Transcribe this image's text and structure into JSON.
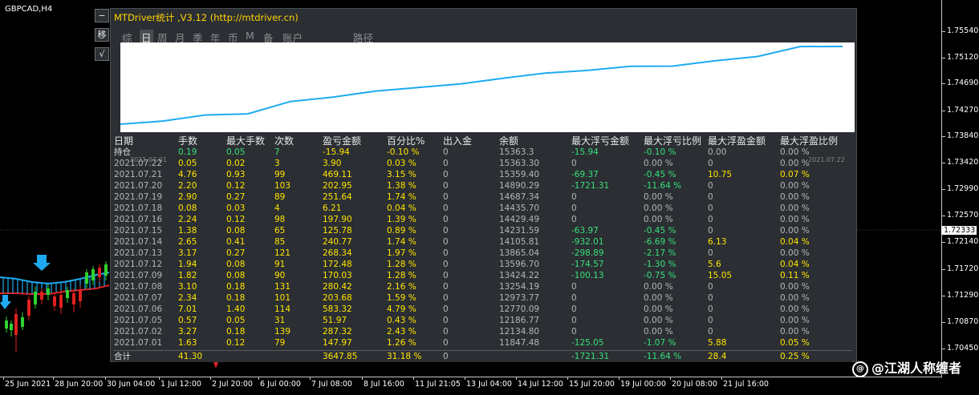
{
  "chart": {
    "symbol": "GBPCAD,H4",
    "price_levels": [
      "1.75540",
      "1.75120",
      "1.74690",
      "1.74270",
      "1.73840",
      "1.73420",
      "1.72990",
      "1.72570",
      "1.72140",
      "1.71720",
      "1.71290",
      "1.70870",
      "1.70450"
    ],
    "current_price": "1.72333",
    "time_labels": [
      "25 Jun 2021",
      "28 Jun 20:00",
      "30 Jun 04:00",
      "1 Jul 12:00",
      "2 Jul 20:00",
      "6 Jul 00:00",
      "7 Jul 08:00",
      "8 Jul 16:00",
      "11 Jul 21:05",
      "13 Jul 04:00",
      "14 Jul 12:00",
      "15 Jul 20:00",
      "19 Jul 00:00",
      "20 Jul 08:00",
      "21 Jul 16:00"
    ]
  },
  "watermark": "@江湖人称缠者",
  "side_buttons": [
    "−",
    "移",
    "√"
  ],
  "panel": {
    "title": "MTDriver统计 ,V3.12 (http://mtdriver.cn)",
    "tabs": [
      "综",
      "日",
      "周",
      "月",
      "季",
      "年",
      "币",
      "M",
      "备",
      "账户",
      "路径"
    ],
    "active_tab": "日",
    "plot_start_date": "2021.07.01",
    "plot_end_date": "2021.07.22",
    "columns": [
      "日期",
      "手数",
      "最大手数",
      "次数",
      "盈亏金额",
      "百分比%",
      "出入金",
      "余额",
      "最大浮亏金额",
      "最大浮亏比例",
      "最大浮盈金额",
      "最大浮盈比例"
    ],
    "holding": [
      "持仓",
      "0.19",
      "0.05",
      "7",
      "-15.94",
      "-0.10 %",
      "0",
      "15363.3",
      "-15.94",
      "-0.10 %",
      "0.00",
      "0.00 %"
    ],
    "rows": [
      [
        "2021.07.22",
        "0.05",
        "0.02",
        "3",
        "3.90",
        "0.03 %",
        "0",
        "15363.30",
        "0",
        "0.00 %",
        "0",
        "0.00 %"
      ],
      [
        "2021.07.21",
        "4.76",
        "0.93",
        "99",
        "469.11",
        "3.15 %",
        "0",
        "15359.40",
        "-69.37",
        "-0.45 %",
        "10.75",
        "0.07 %"
      ],
      [
        "2021.07.20",
        "2.20",
        "0.12",
        "103",
        "202.95",
        "1.38 %",
        "0",
        "14890.29",
        "-1721.31",
        "-11.64 %",
        "0",
        "0.00 %"
      ],
      [
        "2021.07.19",
        "2.90",
        "0.27",
        "89",
        "251.64",
        "1.74 %",
        "0",
        "14687.34",
        "0",
        "0.00 %",
        "0",
        "0.00 %"
      ],
      [
        "2021.07.18",
        "0.08",
        "0.03",
        "4",
        "6.21",
        "0.04 %",
        "0",
        "14435.70",
        "0",
        "0.00 %",
        "0",
        "0.00 %"
      ],
      [
        "2021.07.16",
        "2.24",
        "0.12",
        "98",
        "197.90",
        "1.39 %",
        "0",
        "14429.49",
        "0",
        "0.00 %",
        "0",
        "0.00 %"
      ],
      [
        "2021.07.15",
        "1.38",
        "0.08",
        "65",
        "125.78",
        "0.89 %",
        "0",
        "14231.59",
        "-63.97",
        "-0.45 %",
        "0",
        "0.00 %"
      ],
      [
        "2021.07.14",
        "2.65",
        "0.41",
        "85",
        "240.77",
        "1.74 %",
        "0",
        "14105.81",
        "-932.01",
        "-6.69 %",
        "6.13",
        "0.04 %"
      ],
      [
        "2021.07.13",
        "3.17",
        "0.27",
        "121",
        "268.34",
        "1.97 %",
        "0",
        "13865.04",
        "-298.89",
        "-2.17 %",
        "0",
        "0.00 %"
      ],
      [
        "2021.07.12",
        "1.94",
        "0.08",
        "91",
        "172.48",
        "1.28 %",
        "0",
        "13596.70",
        "-174.57",
        "-1.30 %",
        "5.6",
        "0.04 %"
      ],
      [
        "2021.07.09",
        "1.82",
        "0.08",
        "90",
        "170.03",
        "1.28 %",
        "0",
        "13424.22",
        "-100.13",
        "-0.75 %",
        "15.05",
        "0.11 %"
      ],
      [
        "2021.07.08",
        "3.10",
        "0.18",
        "131",
        "280.42",
        "2.16 %",
        "0",
        "13254.19",
        "0",
        "0.00 %",
        "0",
        "0.00 %"
      ],
      [
        "2021.07.07",
        "2.34",
        "0.18",
        "101",
        "203.68",
        "1.59 %",
        "0",
        "12973.77",
        "0",
        "0.00 %",
        "0",
        "0.00 %"
      ],
      [
        "2021.07.06",
        "7.01",
        "1.40",
        "114",
        "583.32",
        "4.79 %",
        "0",
        "12770.09",
        "0",
        "0.00 %",
        "0",
        "0.00 %"
      ],
      [
        "2021.07.05",
        "0.57",
        "0.05",
        "31",
        "51.97",
        "0.43 %",
        "0",
        "12186.77",
        "0",
        "0.00 %",
        "0",
        "0.00 %"
      ],
      [
        "2021.07.02",
        "3.27",
        "0.18",
        "139",
        "287.32",
        "2.43 %",
        "0",
        "12134.80",
        "0",
        "0.00 %",
        "0",
        "0.00 %"
      ],
      [
        "2021.07.01",
        "1.63",
        "0.12",
        "79",
        "147.97",
        "1.26 %",
        "0",
        "11847.48",
        "-125.05",
        "-1.07 %",
        "5.88",
        "0.05 %"
      ]
    ],
    "total": [
      "合计",
      "41.30",
      "",
      "",
      "3647.85",
      "31.18 %",
      "0",
      "",
      "-1721.31",
      "-11.64 %",
      "28.4",
      "0.25 %"
    ],
    "balance_curve": [
      11700,
      11847.48,
      12134.8,
      12186.77,
      12770.09,
      12973.77,
      13254.19,
      13424.22,
      13596.7,
      13865.04,
      14105.81,
      14231.59,
      14429.49,
      14435.7,
      14687.34,
      14890.29,
      15359.4,
      15363.3
    ],
    "colors": {
      "title": "#ffd400",
      "line": "#1eaaf0",
      "yellow": "#ffe600",
      "green": "#39e07a"
    }
  }
}
